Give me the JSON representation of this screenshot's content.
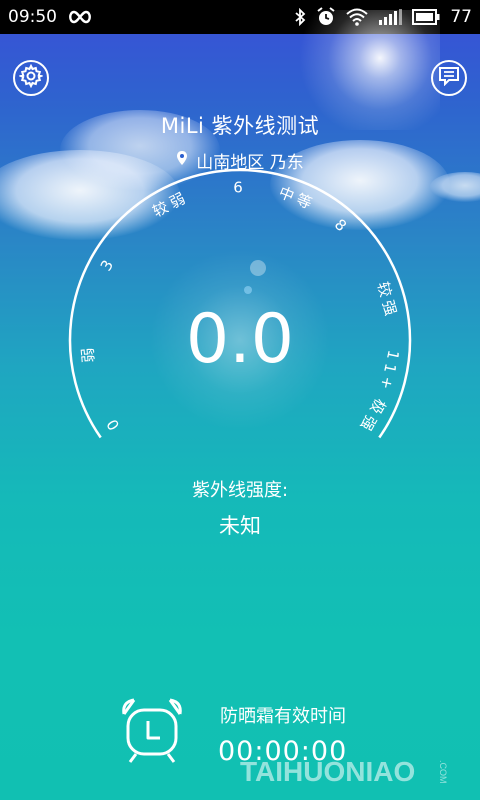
{
  "status_bar": {
    "time": "09:50",
    "infinity_icon": "infinity-icon",
    "icons": [
      "bluetooth-icon",
      "alarm-icon",
      "wifi-icon",
      "signal-icon",
      "battery-icon"
    ],
    "battery": "77"
  },
  "header": {
    "settings_icon": "gear-icon",
    "chat_icon": "chat-icon",
    "title": "MiLi 紫外线测试",
    "location_icon": "location-pin-icon",
    "location": "山南地区 乃东"
  },
  "gauge": {
    "value": "0.0",
    "ticks": {
      "t0": "0",
      "t3": "3",
      "t6": "6",
      "t8": "8",
      "t11": "11+"
    },
    "levels": {
      "weak": "弱",
      "weaker": "较弱",
      "medium": "中等",
      "stronger": "较强",
      "very_strong": "极强"
    }
  },
  "intensity": {
    "label": "紫外线强度:",
    "value": "未知"
  },
  "sunscreen": {
    "icon": "alarm-clock-icon",
    "label": "防晒霜有效时间",
    "time": "00:00:00"
  },
  "watermark": {
    "text": "TAIHUONIAO",
    "sub": ".COM"
  },
  "colors": {
    "sky_top": "#3a4fd8",
    "sky_bottom": "#11c0b2",
    "foreground": "#ffffff"
  }
}
